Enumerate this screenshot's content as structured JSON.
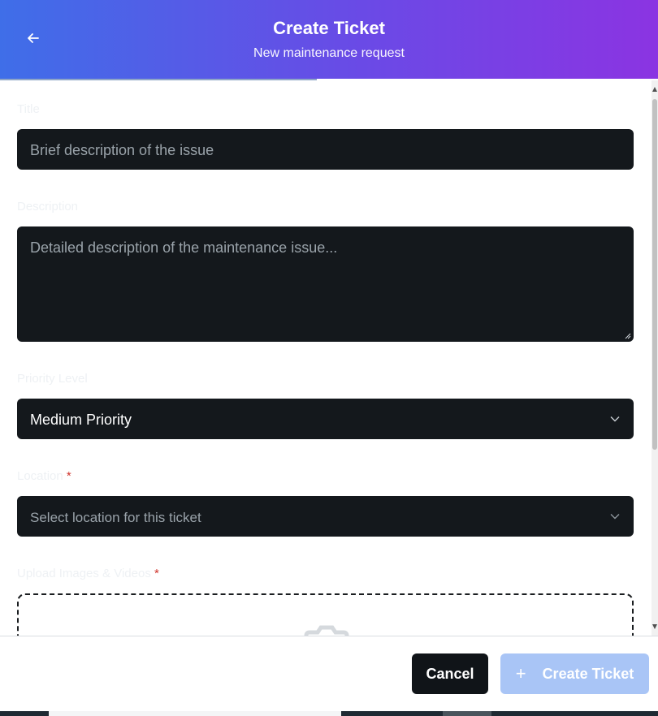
{
  "header": {
    "title": "Create Ticket",
    "subtitle": "New maintenance request",
    "back_icon": "arrow-left-icon"
  },
  "form": {
    "title": {
      "label": "Title",
      "placeholder": "Brief description of the issue"
    },
    "description": {
      "label": "Description",
      "placeholder": "Detailed description of the maintenance issue..."
    },
    "priority": {
      "label": "Priority Level",
      "selected": "Medium Priority"
    },
    "location": {
      "label": "Location",
      "required_mark": "*",
      "placeholder": "Select location for this ticket"
    },
    "upload": {
      "label": "Upload Images & Videos",
      "required_mark": "*",
      "icon": "camera-icon"
    }
  },
  "footer": {
    "cancel_label": "Cancel",
    "create_label": "Create Ticket",
    "create_icon": "+"
  },
  "colors": {
    "header_gradient_start": "#3f6ee8",
    "header_gradient_end": "#8b34e2",
    "field_bg": "#14181c",
    "cancel_bg": "#101418",
    "create_bg_disabled": "#a9c5f6",
    "required": "#d0342c"
  }
}
